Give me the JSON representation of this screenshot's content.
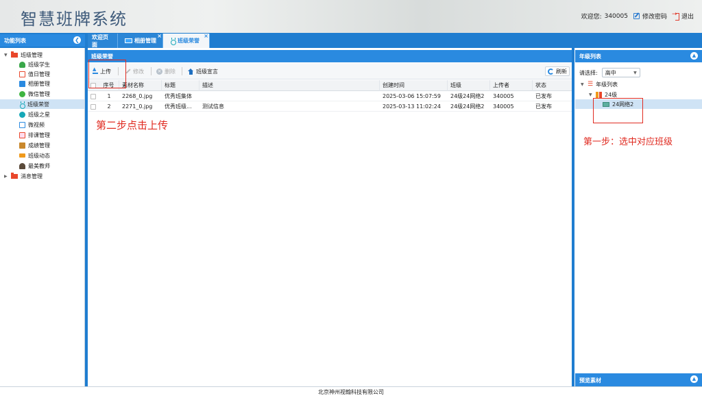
{
  "header": {
    "app_title": "智慧班牌系统",
    "welcome_label": "欢迎您:",
    "user_id": "340005",
    "change_password": "修改密码",
    "logout": "退出"
  },
  "sidebar": {
    "title": "功能列表",
    "groups": [
      {
        "label": "班级管理",
        "items": [
          {
            "label": "班级学生",
            "icon": "student-icon"
          },
          {
            "label": "值日管理",
            "icon": "calendar-icon"
          },
          {
            "label": "相册管理",
            "icon": "album-icon"
          },
          {
            "label": "微信管理",
            "icon": "wechat-icon"
          },
          {
            "label": "班级荣誉",
            "icon": "medal-icon",
            "selected": true
          },
          {
            "label": "班级之星",
            "icon": "star-icon"
          },
          {
            "label": "微视频",
            "icon": "video-icon"
          },
          {
            "label": "排课管理",
            "icon": "schedule-icon"
          },
          {
            "label": "成绩管理",
            "icon": "grade-icon"
          },
          {
            "label": "班级动态",
            "icon": "flag-icon"
          },
          {
            "label": "最美教师",
            "icon": "teacher-icon"
          }
        ]
      },
      {
        "label": "消息管理",
        "items": []
      }
    ]
  },
  "tabs": [
    {
      "label": "欢迎页面",
      "closable": false,
      "active": false
    },
    {
      "label": "相册管理",
      "closable": true,
      "active": false
    },
    {
      "label": "班级荣誉",
      "closable": true,
      "active": true
    }
  ],
  "main": {
    "panel_title": "班级荣誉",
    "toolbar": {
      "upload": "上传",
      "edit": "修改",
      "delete": "删除",
      "motto": "班级宣言",
      "refresh": "刷新"
    },
    "columns": [
      "序号",
      "素材名称",
      "标题",
      "描述",
      "创建时间",
      "班级",
      "上传者",
      "状态"
    ],
    "rows": [
      {
        "no": "1",
        "name": "2268_0.jpg",
        "title": "优秀班集体",
        "desc": "",
        "created": "2025-03-06 15:07:59",
        "class": "24级24网络2",
        "uploader": "340005",
        "status": "已发布"
      },
      {
        "no": "2",
        "name": "2271_0.jpg",
        "title": "优秀班级...",
        "desc": "测试信息",
        "created": "2025-03-13 11:02:24",
        "class": "24级24网络2",
        "uploader": "340005",
        "status": "已发布"
      }
    ]
  },
  "annotations": {
    "step2": "第二步点击上传",
    "step1": "第一步：选中对应班级"
  },
  "right_panel": {
    "title": "年级列表",
    "select_label": "请选择:",
    "select_value": "高中",
    "tree_root": "年级列表",
    "grade": "24级",
    "class": "24网络2",
    "footer_title": "预览素材"
  },
  "footer": {
    "text": "北京神州视翰科技有限公司"
  },
  "colors": {
    "accent": "#2a8ae0",
    "annotation": "#e02a20"
  }
}
